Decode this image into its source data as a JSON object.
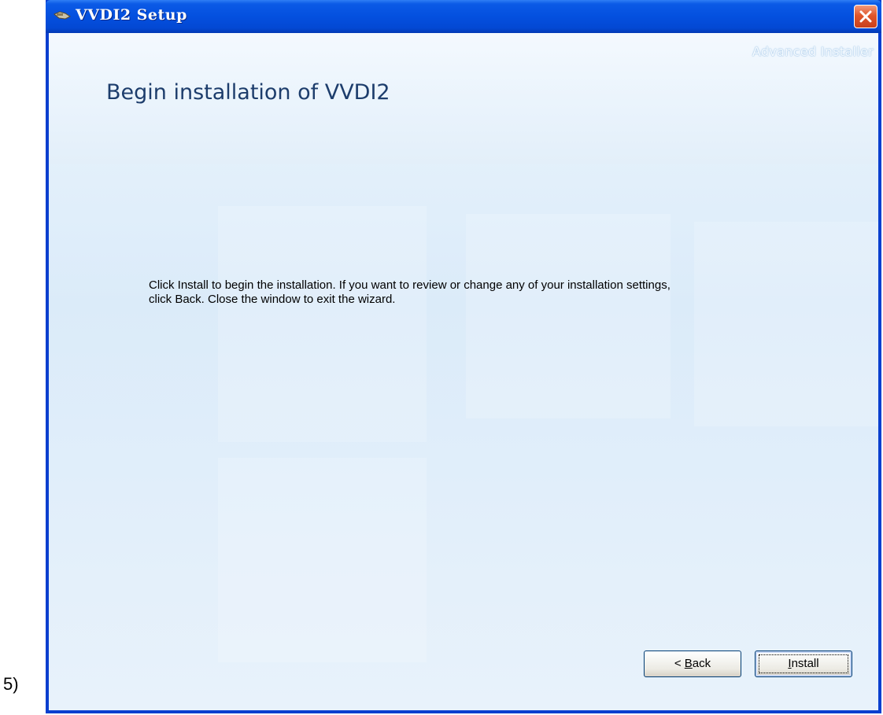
{
  "outer": {
    "step_label": "5)"
  },
  "window": {
    "title": "VVDI2 Setup",
    "icons": {
      "app": "installer-app-icon",
      "close": "close-icon"
    }
  },
  "header": {
    "brand": "Advanced Installer",
    "title": "Begin installation of VVDI2"
  },
  "body": {
    "line1": "Click Install to begin the installation.  If you want to review or change any of your installation settings,",
    "line2": "click Back.  Close the window to exit the wizard."
  },
  "buttons": {
    "back": {
      "prefix": "< ",
      "mnemonic": "B",
      "rest": "ack"
    },
    "install": {
      "prefix": "",
      "mnemonic": "I",
      "rest": "nstall"
    }
  },
  "colors": {
    "title_bar": "#0450df",
    "close_button": "#e0562b",
    "title_text": "#1d3d6c"
  }
}
